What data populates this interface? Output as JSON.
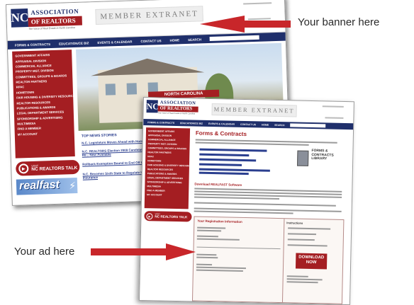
{
  "brand": {
    "logo_initials": "NC",
    "logo_line1": "ASSOCIATION",
    "logo_line2": "OF REALTORS",
    "tagline": "The Voice of Real Estate in North Carolina",
    "header_title": "MEMBER EXTRANET",
    "front_header_title": "MEMBER EXTRANET"
  },
  "nav": {
    "items": [
      "FORMS & CONTRACTS",
      "EDUCATION/CE BIZ",
      "EVENTS & CALENDAR",
      "CONTACT US",
      "HOME",
      "SEARCH"
    ]
  },
  "sidebar": {
    "items": [
      "GOVERNMENT AFFAIRS",
      "APPRAISAL DIVISION",
      "COMMERCIAL ALLIANCE",
      "PROPERTY MGT. DIVISION",
      "COMMITTEES, GROUPS & BOARDS",
      "REALTOR PARTNERS",
      "RPAC",
      "HOMETOWN",
      "FAIR HOUSING & DIVERSITY RESOURCES",
      "REALTOR RESOURCES",
      "PUBLICATIONS & AWARDS",
      "LEGAL DEPARTMENT SERVICES",
      "SPONSORSHIP & ADVERTISING",
      "MULTIMEDIA",
      "FIND A MEMBER",
      "MY ACCOUNT"
    ]
  },
  "talk": {
    "visit": "VISIT",
    "label": "NC REALTORS TALK"
  },
  "realfast": {
    "label": "realfast"
  },
  "back_page": {
    "photo_sign": "NORTH CAROLINA",
    "news_heading": "TOP NEWS STORIES",
    "news": [
      "N.C. Legislature Moves Ahead with Homeo...",
      "N.C. REALTORS Election 2009 Candidate Re... Now Available",
      "Rollback Exemption Bound to End Off the Bo...",
      "N.C. Becomes Sixth State to Regulate Ho... Insurance"
    ]
  },
  "front_page": {
    "title": "Forms & Contracts",
    "library_line1": "FORMS &",
    "library_line2": "CONTRACTS",
    "library_line3": "LIBRARY",
    "section_heading": "Download REALFAST Software",
    "box_heading": "Your Registration Information",
    "instructions_heading": "Instructions",
    "download_line1": "DOWNLOAD",
    "download_line2": "NOW"
  },
  "callouts": {
    "banner": "Your banner here",
    "ad": "Your ad here"
  },
  "colors": {
    "navy": "#1f2f6b",
    "crimson": "#a41e22",
    "arrow_red": "#c8262a"
  }
}
